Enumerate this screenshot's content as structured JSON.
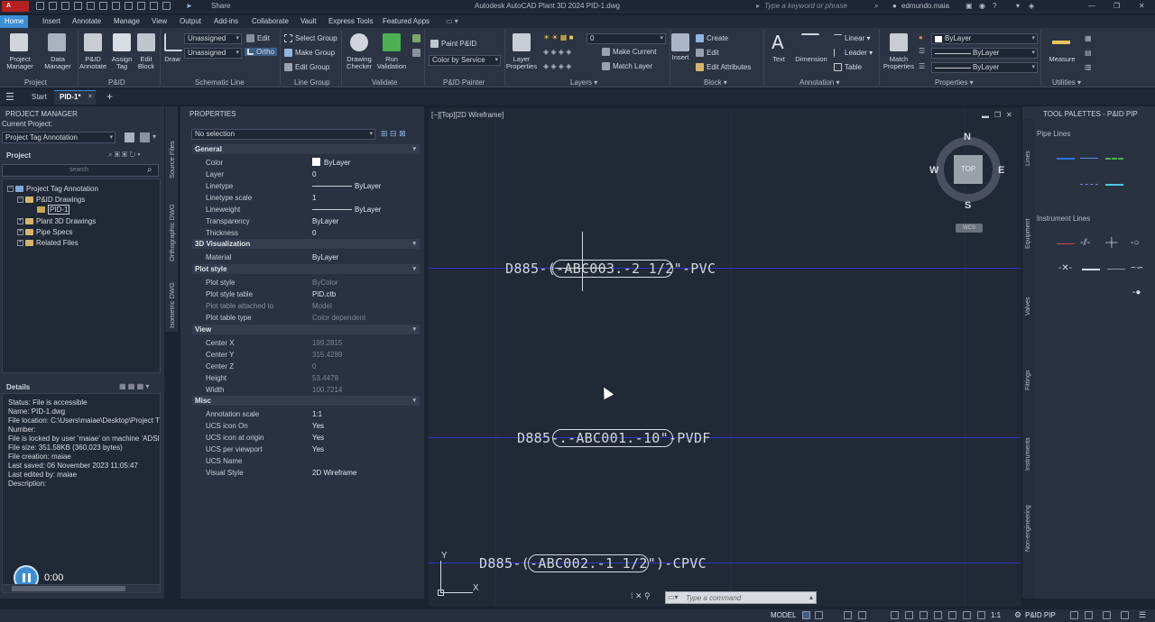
{
  "title": {
    "app_button": "A",
    "share": "Share",
    "text": "Autodesk AutoCAD Plant 3D 2024   PID-1.dwg",
    "search_placeholder": "Type a keyword or phrase",
    "user": "edmundo.maia"
  },
  "ribbon_tabs": [
    "Home",
    "Insert",
    "Annotate",
    "Manage",
    "View",
    "Output",
    "Add-ins",
    "Collaborate",
    "Vault",
    "Express Tools",
    "Featured Apps"
  ],
  "ribbon": {
    "project_manager": "Project\nManager",
    "data_manager": "Data\nManager",
    "pid_annotate": "P&ID\nAnnotate",
    "assign_tag": "Assign\nTag",
    "edit_block": "Edit\nBlock",
    "draw": "Draw",
    "unassigned1": "Unassigned",
    "unassigned2": "Unassigned",
    "edit": "Edit",
    "ortho": "Ortho",
    "select_group": "Select Group",
    "make_group": "Make Group",
    "edit_group": "Edit Group",
    "drawing_checker": "Drawing\nChecker",
    "run_validation": "Run\nValidation",
    "paint_pid": "Paint P&ID",
    "color_by_service": "Color by Service",
    "layer_properties": "Layer\nProperties",
    "layer_value": "0",
    "make_current": "Make Current",
    "match_layer": "Match Layer",
    "insert": "Insert",
    "create": "Create",
    "edit_b": "Edit",
    "edit_attributes": "Edit Attributes",
    "text": "Text",
    "dimension": "Dimension",
    "linear": "Linear",
    "leader": "Leader",
    "table": "Table",
    "match_properties": "Match\nProperties",
    "bylayer": "ByLayer",
    "bylayer2": "ByLayer",
    "bylayer3": "ByLayer",
    "measure": "Measure",
    "panels": {
      "project": "Project",
      "pid": "P&ID",
      "schematic": "Schematic Line",
      "line_group": "Line Group",
      "validate": "Validate",
      "painter": "P&ID Painter",
      "layers": "Layers ▾",
      "block": "Block ▾",
      "annotation": "Annotation ▾",
      "properties": "Properties ▾",
      "utilities": "Utilities ▾"
    }
  },
  "file_tabs": {
    "start": "Start",
    "active": "PID-1*",
    "add": "+"
  },
  "project_manager": {
    "header": "PROJECT MANAGER",
    "current_project_label": "Current Project:",
    "current_project": "Project Tag Annotation",
    "project_label": "Project",
    "search_placeholder": "search",
    "tree": {
      "root": "Project Tag Annotation",
      "pid_drawings": "P&ID Drawings",
      "pid1": "PID-1",
      "plant3d": "Plant 3D Drawings",
      "pipe_specs": "Pipe Specs",
      "related": "Related Files"
    },
    "details_label": "Details",
    "details": [
      "Status: File is accessible",
      "Name: PID-1.dwg",
      "File location: C:\\Users\\maiae\\Desktop\\Project T",
      "Number:",
      "File is locked by user 'maiae' on machine 'ADSI",
      "File size: 351.58KB (360,023 bytes)",
      "File creation: maiae",
      "Last saved: 06 November 2023 11:05:47",
      "Last edited by: maiae",
      "Description:"
    ],
    "timer": "0:00"
  },
  "side_tabs": {
    "source": "Source Files",
    "ortho": "Orthographic DWG",
    "iso": "Isometric DWG"
  },
  "properties": {
    "header": "PROPERTIES",
    "selection": "No selection",
    "sections": {
      "general": "General",
      "viz": "3D Visualization",
      "plot": "Plot style",
      "view": "View",
      "misc": "Misc"
    },
    "general": [
      [
        "Color",
        "ByLayer"
      ],
      [
        "Layer",
        "0"
      ],
      [
        "Linetype",
        "ByLayer"
      ],
      [
        "Linetype scale",
        "1"
      ],
      [
        "Lineweight",
        "ByLayer"
      ],
      [
        "Transparency",
        "ByLayer"
      ],
      [
        "Thickness",
        "0"
      ]
    ],
    "viz": [
      [
        "Material",
        "ByLayer"
      ]
    ],
    "plot": [
      [
        "Plot style",
        "ByColor"
      ],
      [
        "Plot style table",
        "PID.ctb"
      ],
      [
        "Plot table attached to",
        "Model"
      ],
      [
        "Plot table type",
        "Color dependent"
      ]
    ],
    "view": [
      [
        "Center X",
        "199.2815"
      ],
      [
        "Center Y",
        "315.4289"
      ],
      [
        "Center Z",
        "0"
      ],
      [
        "Height",
        "53.4478"
      ],
      [
        "Width",
        "100.7214"
      ]
    ],
    "misc": [
      [
        "Annotation scale",
        "1:1"
      ],
      [
        "UCS icon On",
        "Yes"
      ],
      [
        "UCS icon at origin",
        "Yes"
      ],
      [
        "UCS per viewport",
        "Yes"
      ],
      [
        "UCS Name",
        ""
      ],
      [
        "Visual Style",
        "2D Wireframe"
      ]
    ]
  },
  "canvas": {
    "view_label": "[−][Top][2D Wireframe]",
    "compass": {
      "n": "N",
      "s": "S",
      "e": "E",
      "w": "W",
      "top": "TOP",
      "wcs": "WCS"
    },
    "tags": [
      "D885-(-ABC003.-2 1/2\"-PVC",
      "D885-.-ABC001.-10\"-PVDF",
      "D885-(-ABC002.-1 1/2\")-CPVC"
    ],
    "ucs": {
      "x": "X",
      "y": "Y"
    },
    "command_placeholder": "Type a command"
  },
  "tool_palettes": {
    "header": "TOOL PALETTES - P&ID PIP",
    "pipe_lines": "Pipe Lines",
    "instrument_lines": "Instrument Lines",
    "tabs": [
      "Lines",
      "Equipment",
      "Valves",
      "Fittings",
      "Instruments",
      "Non-engineering"
    ]
  },
  "status": {
    "model": "MODEL",
    "scale": "1:1",
    "workspace": "P&ID PIP"
  },
  "colors": {
    "accent": "#3b8ed6",
    "pipe_line": "#2f38c8",
    "app": "#b5211f"
  }
}
